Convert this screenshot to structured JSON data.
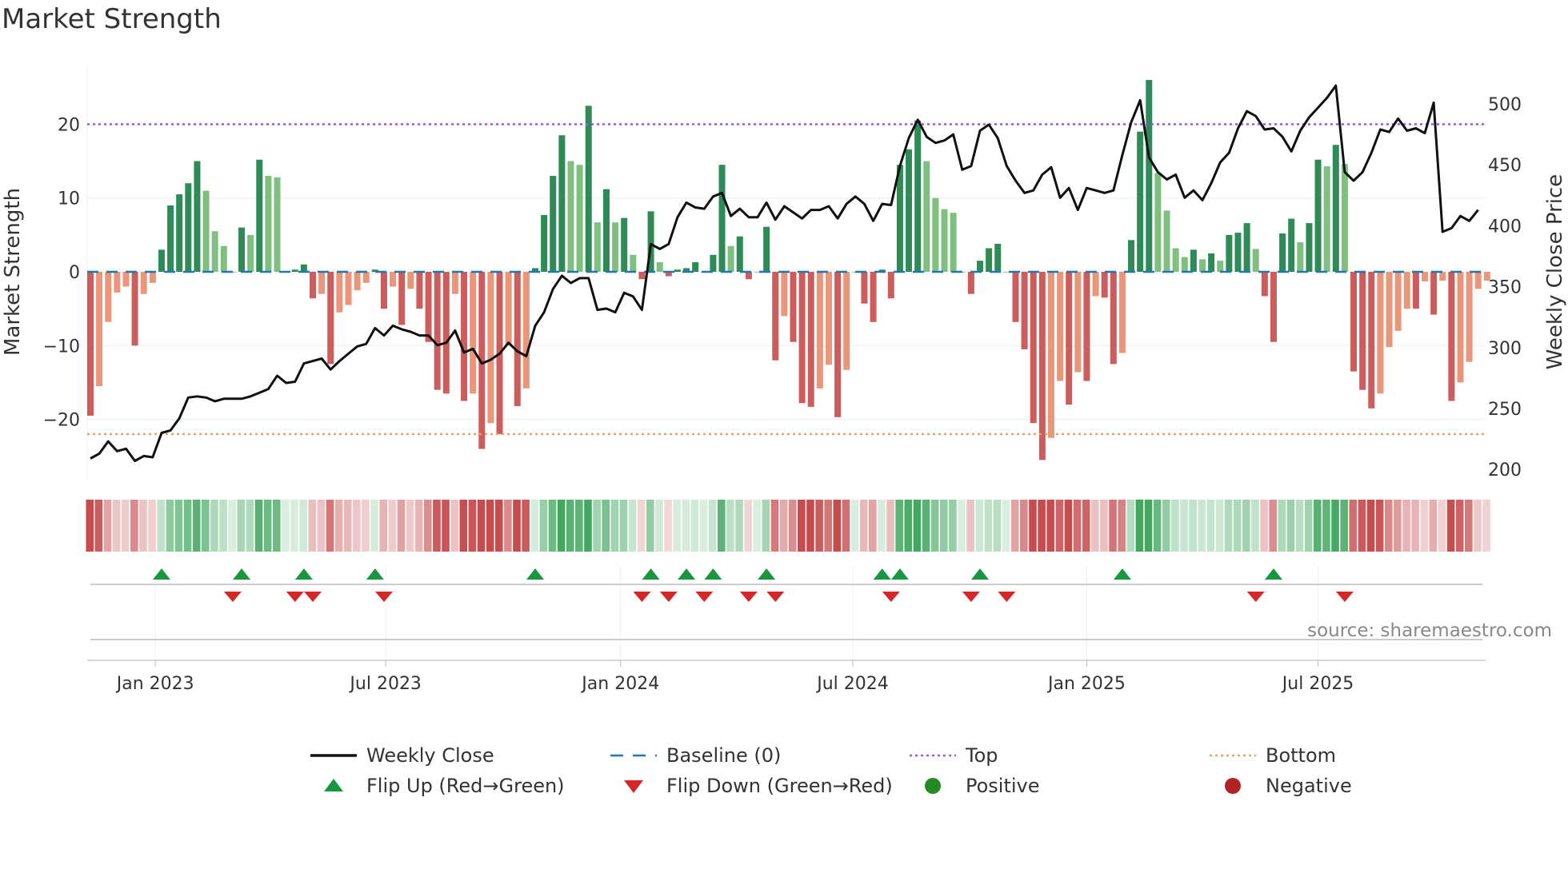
{
  "chart_data": {
    "type": "bar",
    "title": "Market Strength",
    "ylabel": "Market Strength",
    "y2label": "Weekly Close Price",
    "ylim": [
      -27,
      27
    ],
    "y2lim": [
      190,
      530
    ],
    "yticks": [
      -20,
      -10,
      0,
      10,
      20
    ],
    "y2ticks": [
      200,
      250,
      300,
      350,
      400,
      450,
      500
    ],
    "xticks": [
      {
        "label": "Jan 2023",
        "week": 7.3
      },
      {
        "label": "Jul 2023",
        "week": 33.2
      },
      {
        "label": "Jan 2024",
        "week": 59.6
      },
      {
        "label": "Jul 2024",
        "week": 85.7
      },
      {
        "label": "Jan 2025",
        "week": 112.0
      },
      {
        "label": "Jul 2025",
        "week": 138.0
      }
    ],
    "top_level": 20,
    "bottom_level": -22,
    "grid": true,
    "strength": [
      -19.5,
      -15.5,
      -6.8,
      -2.8,
      -2,
      -10,
      -3,
      -1.5,
      3,
      9,
      10.5,
      12,
      15,
      11,
      5.5,
      3.5,
      0,
      6,
      5,
      15.2,
      13,
      12.8,
      0,
      0.3,
      1,
      -3.6,
      -3,
      -12.5,
      -5.5,
      -4.5,
      -2.5,
      -1.5,
      0.3,
      -5,
      -2,
      -7.2,
      -2.3,
      -5,
      -9.5,
      -16,
      -16.5,
      -3,
      -17.5,
      -16.5,
      -24,
      -20.5,
      -22,
      -10,
      -18.2,
      -15.8,
      0.5,
      7.7,
      13,
      18.5,
      15,
      14.5,
      22.5,
      6.7,
      11.2,
      6.7,
      7.3,
      2.3,
      -1,
      8.2,
      1.3,
      -0.6,
      0.3,
      0.5,
      1.3,
      0,
      2.3,
      14.5,
      3.5,
      4.8,
      -1,
      0,
      6.1,
      -12,
      -6,
      -9.5,
      -17.8,
      -18.3,
      -15.8,
      -12.6,
      -19.7,
      -13.3,
      0,
      -4.3,
      -6.8,
      0.3,
      -3.6,
      14.5,
      16.6,
      20.5,
      15,
      10,
      8.5,
      8,
      0,
      -3,
      1.5,
      3.2,
      3.8,
      0,
      -6.8,
      -10.5,
      -20.5,
      -25.5,
      -22.5,
      -14.8,
      -18,
      -13.6,
      -14.8,
      -3.3,
      -3.5,
      -12.5,
      -11,
      4.3,
      19,
      26,
      13.4,
      8.3,
      3.2,
      2,
      3,
      1.7,
      2.5,
      1.5,
      5,
      5.3,
      6.6,
      3.1,
      -3.3,
      -9.5,
      5.2,
      7.2,
      4,
      6.6,
      15.2,
      14.3,
      17.2,
      14.6,
      -13.5,
      -16,
      -18.5,
      -16.5,
      -10.2,
      -8,
      -5,
      -5,
      -1.3,
      -5.8,
      -1.2,
      -17.5,
      -15,
      -12.2,
      -2.3,
      -1.2
    ],
    "weekly_close": [
      209,
      213,
      223,
      215,
      217,
      207,
      211,
      210,
      230,
      232,
      242,
      259,
      260,
      259,
      256,
      258,
      258,
      258,
      260,
      263,
      266,
      277,
      271,
      272,
      287,
      289,
      291,
      282,
      289,
      295,
      301,
      303,
      316,
      310,
      318,
      315,
      313,
      310,
      310,
      302,
      304,
      314,
      296,
      299,
      287,
      290,
      295,
      304,
      297,
      293,
      318,
      329,
      348,
      359,
      353,
      357,
      357,
      331,
      332,
      329,
      345,
      342,
      331,
      385,
      381,
      385,
      407,
      419,
      415,
      414,
      424,
      427,
      408,
      414,
      407,
      407,
      419,
      405,
      416,
      411,
      406,
      413,
      413,
      416,
      406,
      418,
      424,
      418,
      404,
      418,
      417,
      449,
      472,
      487,
      473,
      468,
      470,
      475,
      446,
      449,
      478,
      483,
      472,
      449,
      437,
      427,
      429,
      442,
      448,
      423,
      431,
      413,
      431,
      429,
      427,
      429,
      458,
      485,
      503,
      456,
      444,
      438,
      442,
      423,
      429,
      421,
      435,
      452,
      460,
      480,
      494,
      490,
      479,
      480,
      473,
      461,
      478,
      489,
      497,
      505,
      515,
      444,
      437,
      444,
      460,
      479,
      477,
      488,
      478,
      480,
      476,
      501,
      395,
      398,
      408,
      404,
      413
    ],
    "flip_up_weeks": [
      8,
      17,
      24,
      32,
      50,
      63,
      67,
      70,
      76,
      89,
      91,
      100,
      116,
      133
    ],
    "flip_down_weeks": [
      16,
      23,
      25,
      33,
      62,
      65,
      69,
      74,
      77,
      90,
      99,
      103,
      131,
      141
    ],
    "legend": [
      {
        "label": "Weekly Close",
        "symbol": "line",
        "color": "#111111"
      },
      {
        "label": "Baseline (0)",
        "symbol": "dash",
        "color": "#1f77b4"
      },
      {
        "label": "Top",
        "symbol": "dot",
        "color": "#9b59e0"
      },
      {
        "label": "Bottom",
        "symbol": "dot",
        "color": "#f0a060"
      },
      {
        "label": "Flip Up (Red→Green)",
        "symbol": "triangle-up",
        "color": "#1a9641"
      },
      {
        "label": "Flip Down (Green→Red)",
        "symbol": "triangle-down",
        "color": "#d62728"
      },
      {
        "label": "Positive",
        "symbol": "circle",
        "color": "#228b22"
      },
      {
        "label": "Negative",
        "symbol": "circle",
        "color": "#b22222"
      }
    ],
    "legend_position": "bottom",
    "source": "source: sharemaestro.com"
  },
  "colors": {
    "pos_strong": "#2e8b57",
    "pos_weak": "#7fbf7f",
    "neg_strong": "#cd5c5c",
    "neg_weak": "#e9967a"
  }
}
